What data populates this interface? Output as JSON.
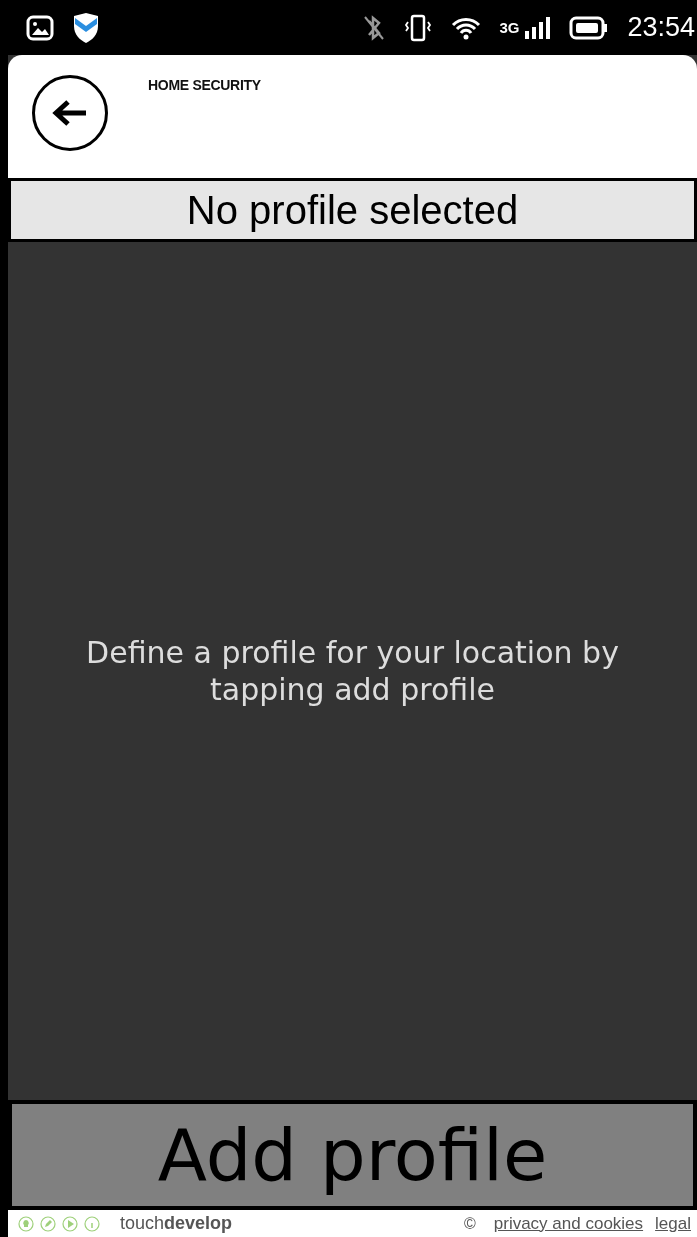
{
  "status_bar": {
    "time": "23:54",
    "network": "3G"
  },
  "header": {
    "title": "HOME SECURITY"
  },
  "profile_banner": {
    "text": "No profile selected"
  },
  "empty_message": "Define a profile for your location by tapping add profile",
  "add_button": {
    "label": "Add profile"
  },
  "footer": {
    "brand": "touch**develop**",
    "copyright": "©",
    "links": [
      "privacy and cookies",
      "legal"
    ]
  }
}
